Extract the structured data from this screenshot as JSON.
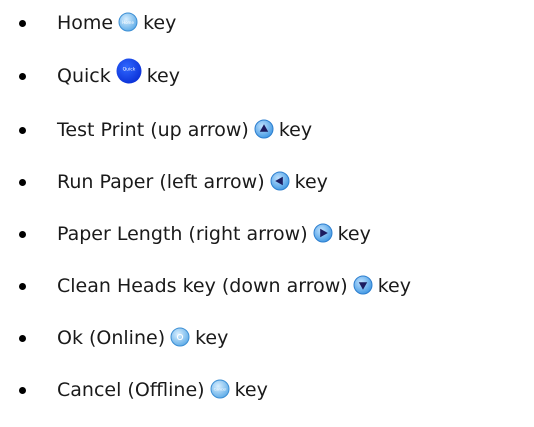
{
  "keys": {
    "items": [
      {
        "label": "Home",
        "suffix": "key",
        "icon": "home-key-icon",
        "icon_text": "Home",
        "color": "#6bb6ec"
      },
      {
        "label": "Quick",
        "suffix": "key",
        "icon": "quick-key-icon",
        "icon_text": "Quick",
        "color": "#0636e6"
      },
      {
        "label": "Test Print (up arrow)",
        "suffix": "key",
        "icon": "up-arrow-key-icon",
        "color": "#4aa2ea"
      },
      {
        "label": "Run Paper (left arrow)",
        "suffix": "key",
        "icon": "left-arrow-key-icon",
        "color": "#4aa2ea"
      },
      {
        "label": "Paper Length (right arrow)",
        "suffix": "key",
        "icon": "right-arrow-key-icon",
        "color": "#4aa2ea"
      },
      {
        "label": "Clean Heads key (down arrow)",
        "suffix": "key",
        "icon": "down-arrow-key-icon",
        "color": "#4aa2ea"
      },
      {
        "label": "Ok (Online)",
        "suffix": "key",
        "icon": "ok-key-icon",
        "color": "#6bb6ec"
      },
      {
        "label": "Cancel (Offline)",
        "suffix": "key",
        "icon": "cancel-key-icon",
        "icon_text": "Cancel",
        "color": "#6bb6ec"
      }
    ]
  }
}
